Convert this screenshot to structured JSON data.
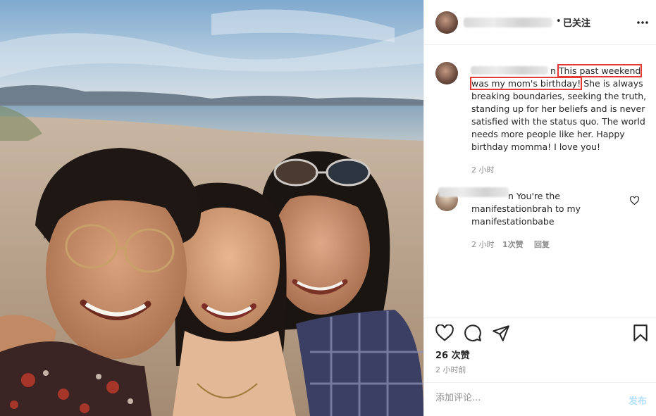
{
  "header": {
    "follow_dot": "•",
    "follow_label": "已关注"
  },
  "caption": {
    "username_fragment": "n",
    "highlight_line1": "This past weekend",
    "highlight_line2": "was my mom's birthday!",
    "rest": " She is always breaking boundaries, seeking the truth, standing up for her beliefs and is never satisfied with the status quo. The world needs more people like her. Happy birthday momma! I love you!",
    "time": "2 小时"
  },
  "comment": {
    "username_fragment": "n",
    "text": " You're the manifestationbrah to my manifestationbabe",
    "time": "2 小时",
    "likes": "1次赞",
    "reply": "回复"
  },
  "actions": {
    "like_icon": "heart-icon",
    "comment_icon": "comment-icon",
    "share_icon": "share-icon",
    "save_icon": "bookmark-icon"
  },
  "likes_label": "26 次赞",
  "posted_ago": "2 小时前",
  "comment_box": {
    "placeholder": "添加评论...",
    "post_label": "发布"
  },
  "colors": {
    "highlight_box": "#e53935",
    "muted_text": "#8e8e8e",
    "post_button": "#b2dffc"
  }
}
